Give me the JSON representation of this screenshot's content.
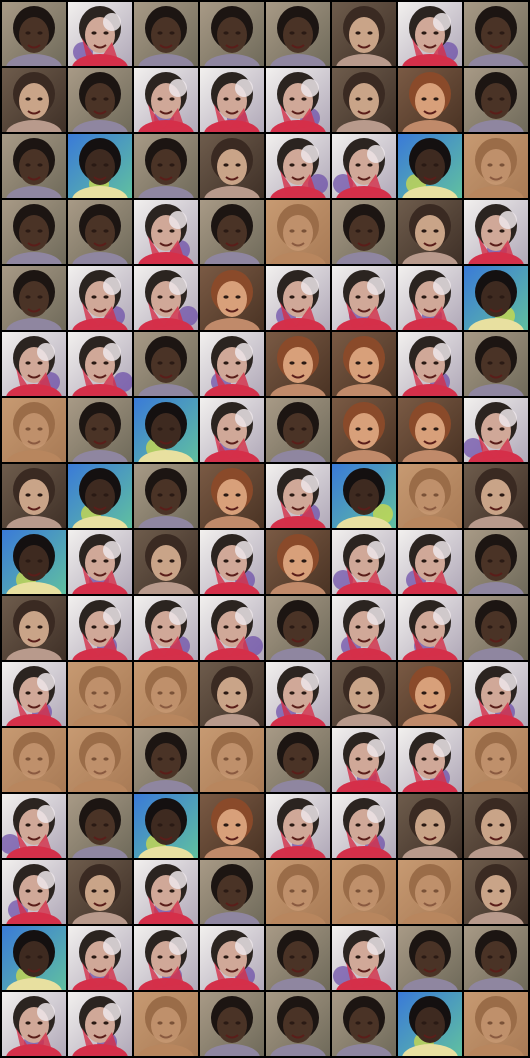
{
  "grid": {
    "rows": 16,
    "cols": 8,
    "palette": {
      "dark": {
        "bg1": "#a89a86",
        "bg2": "#6f6a5a",
        "skin": "#4a3326",
        "hair": "#1c1512",
        "shirt": "#8f86a0"
      },
      "light": {
        "bg1": "#6e5c4c",
        "bg2": "#3f3027",
        "skin": "#c9a488",
        "hair": "#3a2a22",
        "shirt": "#b89a8c"
      },
      "redhair": {
        "bg1": "#7a5a44",
        "bg2": "#4a3324",
        "skin": "#d8a07a",
        "hair": "#8a4a2a",
        "shirt": "#c08a6a"
      },
      "color": {
        "bg1": "#f2f0ee",
        "bg2": "#b0a8b8",
        "skin": "#d0a898",
        "hair": "#2b2420",
        "shirt": "#d4304a",
        "accent": "#6a4aa8"
      },
      "blur": {
        "bg1": "#c79a72",
        "bg2": "#a87a55",
        "skin": "#c89a74",
        "hair": "#9a6c48",
        "shirt": "#b8865e"
      },
      "blue": {
        "bg1": "#3a7ad8",
        "bg2": "#60c0a0",
        "skin": "#3e2a20",
        "hair": "#141010",
        "shirt": "#e8e0a0",
        "accent": "#d8e040"
      }
    },
    "tiles": [
      "dark",
      "color",
      "dark",
      "dark",
      "dark",
      "light",
      "color",
      "dark",
      "light",
      "dark",
      "color",
      "color",
      "color",
      "light",
      "redhair",
      "dark",
      "dark",
      "blue",
      "dark",
      "light",
      "color",
      "color",
      "blue",
      "blur",
      "dark",
      "dark",
      "color",
      "dark",
      "blur",
      "dark",
      "light",
      "color",
      "dark",
      "color",
      "color",
      "redhair",
      "color",
      "color",
      "color",
      "blue",
      "color",
      "color",
      "dark",
      "color",
      "redhair",
      "redhair",
      "color",
      "dark",
      "blur",
      "dark",
      "blue",
      "color",
      "dark",
      "redhair",
      "redhair",
      "color",
      "light",
      "blue",
      "dark",
      "redhair",
      "color",
      "blue",
      "blur",
      "light",
      "blue",
      "color",
      "light",
      "color",
      "redhair",
      "color",
      "color",
      "dark",
      "light",
      "color",
      "color",
      "color",
      "dark",
      "color",
      "color",
      "dark",
      "color",
      "blur",
      "blur",
      "light",
      "color",
      "light",
      "redhair",
      "color",
      "blur",
      "blur",
      "dark",
      "blur",
      "dark",
      "color",
      "color",
      "blur",
      "color",
      "dark",
      "blue",
      "redhair",
      "color",
      "color",
      "light",
      "light",
      "color",
      "light",
      "color",
      "dark",
      "blur",
      "blur",
      "blur",
      "light",
      "blue",
      "color",
      "color",
      "color",
      "dark",
      "color",
      "dark",
      "dark",
      "color",
      "color",
      "blur",
      "dark",
      "dark",
      "dark",
      "blue",
      "blur"
    ]
  }
}
